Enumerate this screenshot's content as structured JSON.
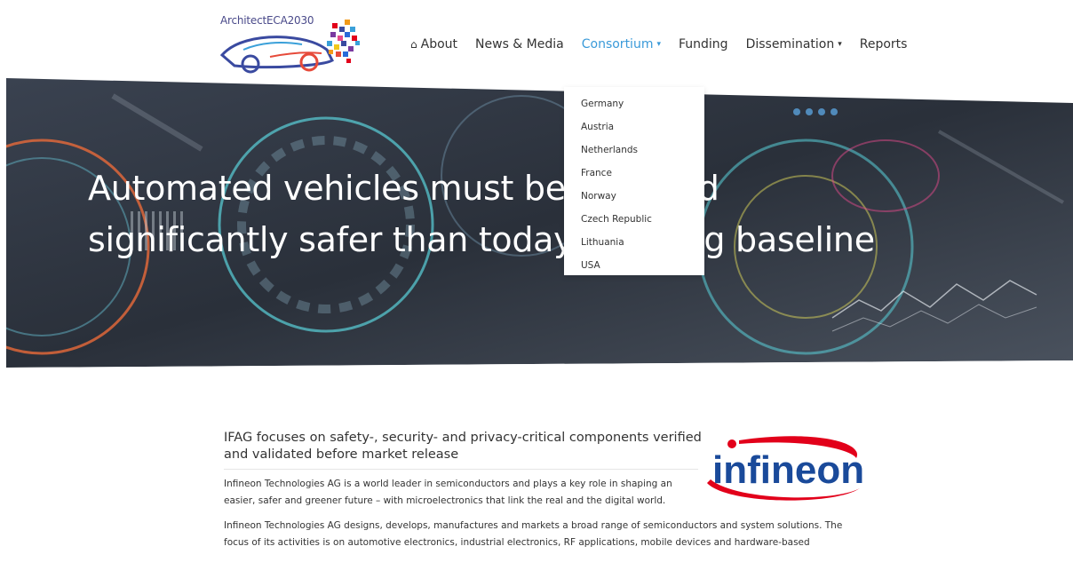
{
  "brand": {
    "logo_text": "ArchitectECA2030"
  },
  "nav": {
    "items": [
      {
        "label": "About",
        "icon": "home-icon",
        "active": false,
        "has_caret": false
      },
      {
        "label": "News & Media",
        "active": false,
        "has_caret": false
      },
      {
        "label": "Consortium",
        "active": true,
        "has_caret": true
      },
      {
        "label": "Funding",
        "active": false,
        "has_caret": false
      },
      {
        "label": "Dissemination",
        "active": false,
        "has_caret": true
      },
      {
        "label": "Reports",
        "active": false,
        "has_caret": false
      }
    ]
  },
  "dropdown": {
    "items": [
      "Germany",
      "Austria",
      "Netherlands",
      "France",
      "Norway",
      "Czech Republic",
      "Lithuania",
      "USA"
    ]
  },
  "hero": {
    "line1": "Automated vehicles must be safe and",
    "line2": "significantly safer than today's driving baseline"
  },
  "content": {
    "headline": "IFAG focuses on safety-, security- and privacy-critical components verified and validated before market release",
    "para1": "Infineon Technologies AG is a world leader in semiconductors and plays a key role in shaping an easier, safer and greener future – with microelectronics that link the real and the digital world.",
    "para2": "Infineon Technologies AG designs, develops, manufactures and markets a broad range of semiconductors and system solutions. The focus of its activities is on automotive electronics, industrial electronics, RF applications, mobile devices and hardware-based"
  },
  "partner_logo": {
    "text": "infineon"
  },
  "colors": {
    "accent": "#3a9ad9",
    "hero_dark": "#2c3440",
    "infineon_blue": "#1a4a9a",
    "infineon_red": "#e2001a"
  }
}
